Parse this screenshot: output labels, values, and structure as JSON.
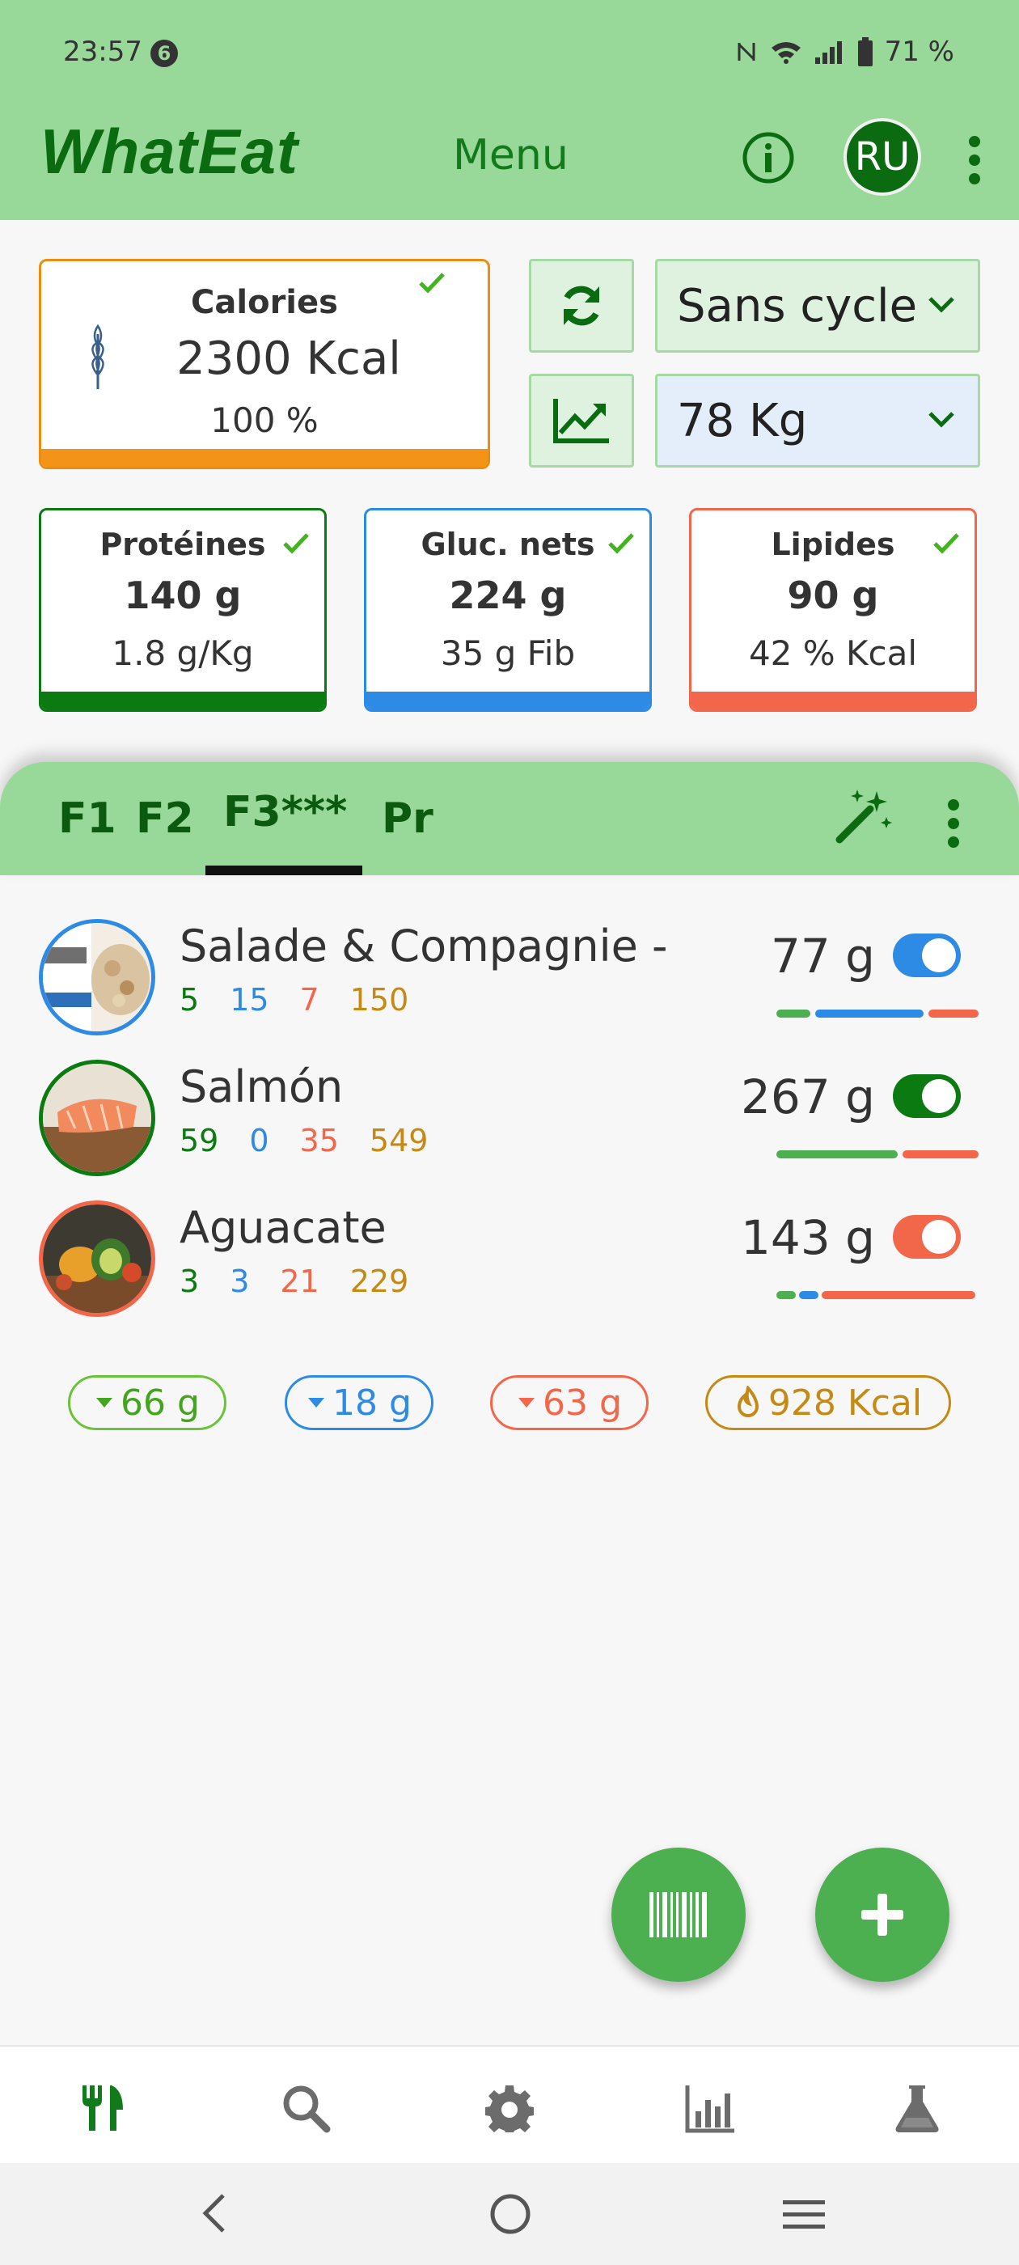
{
  "status_bar": {
    "time": "23:57",
    "notif_count": "6",
    "battery": "71 %"
  },
  "header": {
    "app_title": "WhatEat",
    "menu_label": "Menu",
    "avatar_initials": "RU"
  },
  "calories": {
    "title": "Calories",
    "value": "2300 Kcal",
    "percent": "100 %"
  },
  "cycle_select": {
    "value": "Sans cycle"
  },
  "weight_select": {
    "value": "78 Kg"
  },
  "macros": [
    {
      "name": "Protéines",
      "grams": "140 g",
      "sub": "1.8 g/Kg"
    },
    {
      "name": "Gluc. nets",
      "grams": "224 g",
      "sub": "35 g Fib"
    },
    {
      "name": "Lipides",
      "grams": "90 g",
      "sub": "42 % Kcal"
    }
  ],
  "meal_tabs": [
    {
      "label": "F1"
    },
    {
      "label": "F2"
    },
    {
      "label": "F3***"
    },
    {
      "label": "Pr"
    }
  ],
  "active_tab": "F3***",
  "foods": [
    {
      "name": "Salade & Compagnie -",
      "protein": "5",
      "carbs": "15",
      "fat": "7",
      "kcal": "150",
      "qty": "77 g",
      "enabled": true
    },
    {
      "name": "Salmón",
      "protein": "59",
      "carbs": "0",
      "fat": "35",
      "kcal": "549",
      "qty": "267 g",
      "enabled": true
    },
    {
      "name": "Aguacate",
      "protein": "3",
      "carbs": "3",
      "fat": "21",
      "kcal": "229",
      "qty": "143 g",
      "enabled": true
    }
  ],
  "remaining": {
    "protein": "66 g",
    "carbs": "18 g",
    "fat": "63 g",
    "kcal": "928 Kcal"
  },
  "colors": {
    "header_green": "#98d99a",
    "dark_green": "#0b6b10",
    "protein": "#0b7a10",
    "carbs": "#2d8be6",
    "fat": "#f2674a",
    "kcal": "#c58a14",
    "calorie_orange": "#f39317",
    "fab": "#4caf50"
  }
}
